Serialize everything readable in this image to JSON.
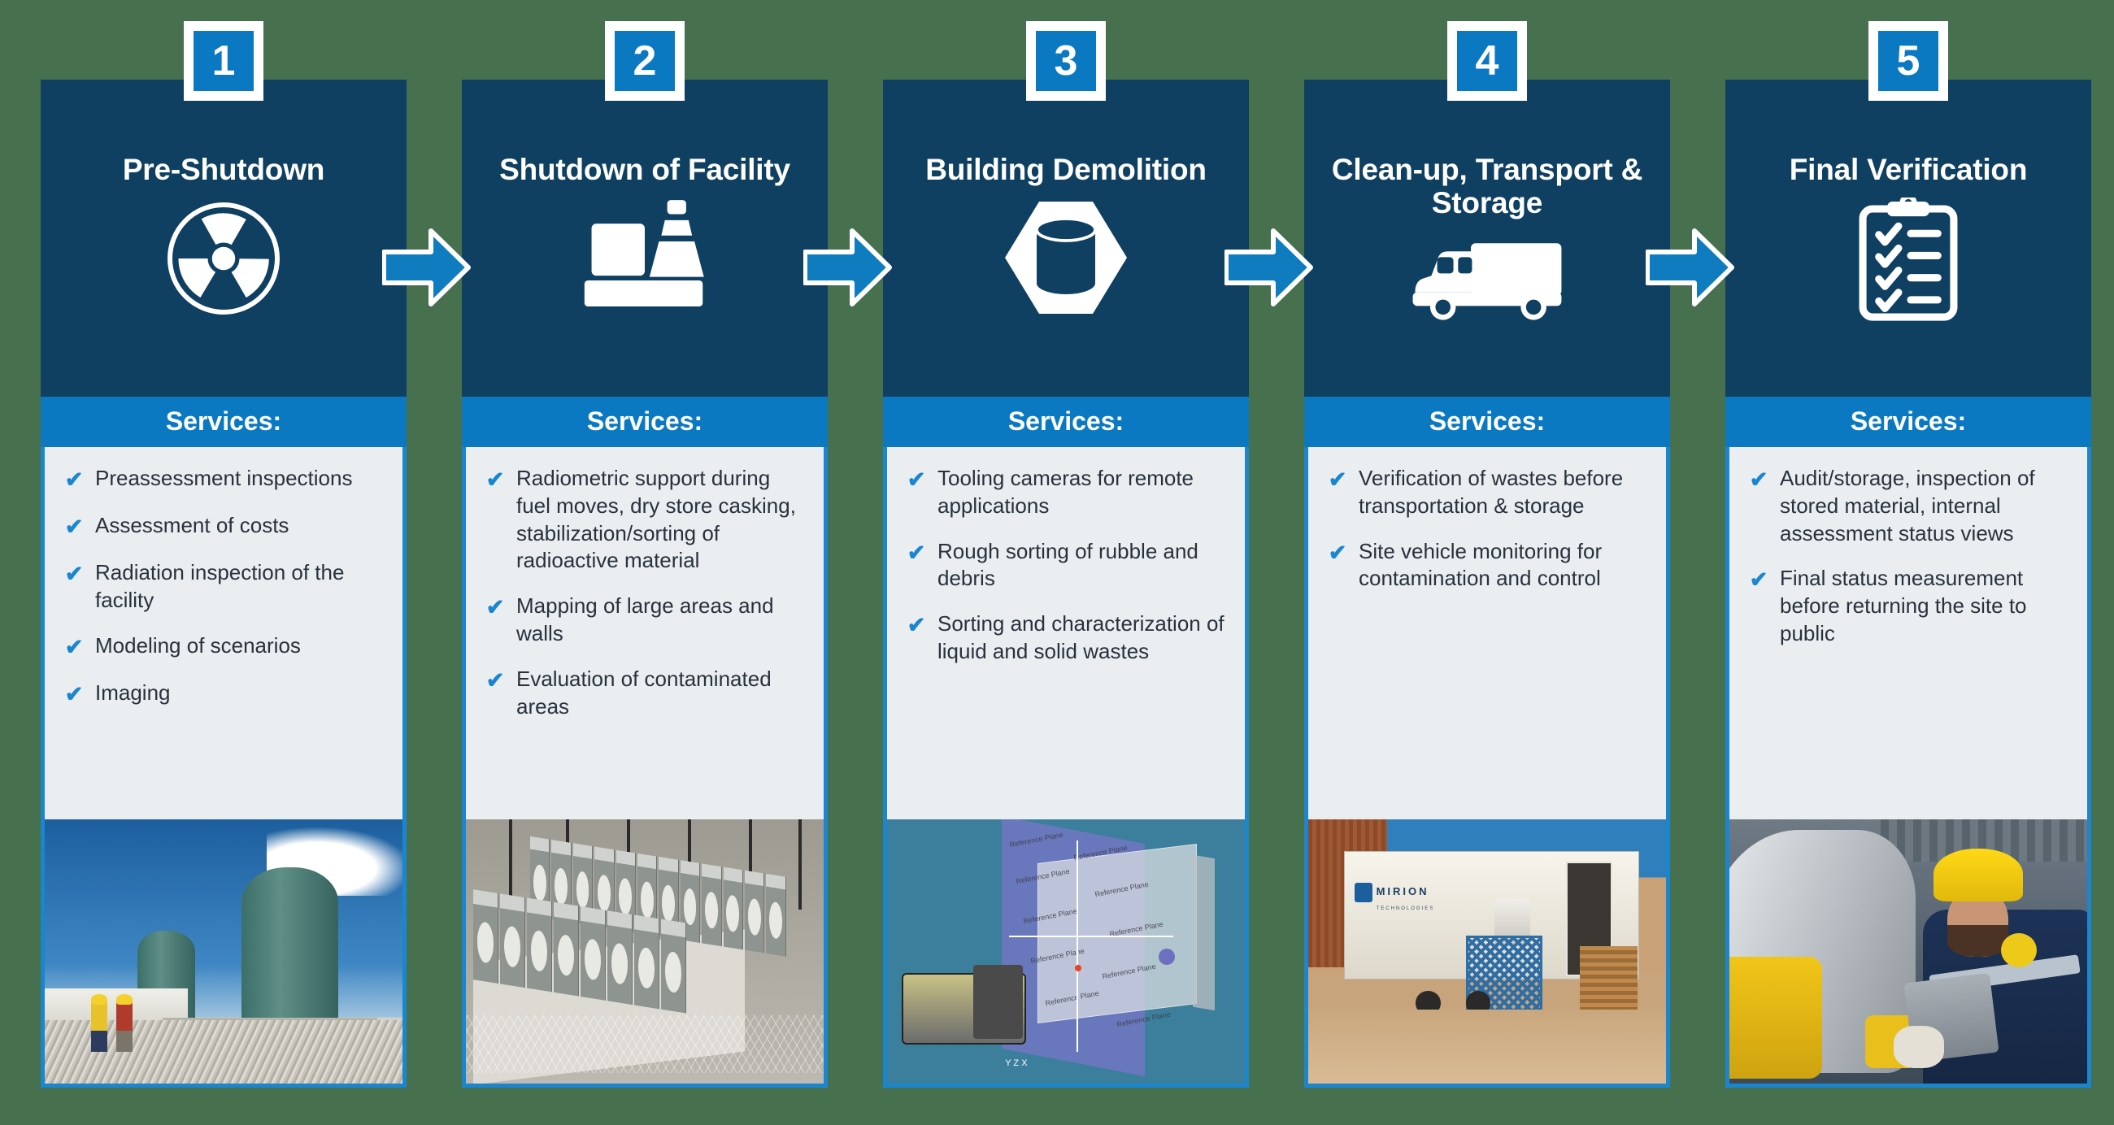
{
  "palette": {
    "background": "#47704f",
    "panel_dark": "#0f3f61",
    "accent_blue": "#0a79c1",
    "border_blue": "#1a86d0",
    "list_bg": "#eaeef1",
    "text_dark": "#28323c",
    "white": "#ffffff"
  },
  "services_label": "Services:",
  "check_glyph": "✔",
  "steps": [
    {
      "number": "1",
      "title": "Pre-Shutdown",
      "icon": "radiation-trefoil-icon",
      "services_label": "Services:",
      "items": [
        "Preassessment inspections",
        "Assessment of costs",
        "Radiation inspection of the facility",
        "Modeling of scenarios",
        "Imaging"
      ],
      "photo": "nuclear-cooling-towers-photo"
    },
    {
      "number": "2",
      "title": "Shutdown of Facility",
      "icon": "facility-cone-icon",
      "services_label": "Services:",
      "items": [
        "Radiometric support during fuel moves, dry store casking, stabilization/sorting of radioactive material",
        "Mapping of large areas and walls",
        "Evaluation of contaminated areas"
      ],
      "photo": "dry-cask-storage-photo"
    },
    {
      "number": "3",
      "title": "Building Demolition",
      "icon": "hexagon-cylinder-icon",
      "services_label": "Services:",
      "items": [
        "Tooling cameras for remote applications",
        "Rough sorting of rubble and debris",
        "Sorting and characterization of liquid and solid wastes"
      ],
      "photo": "3d-reference-plane-model-photo"
    },
    {
      "number": "4",
      "title": "Clean-up, Transport & Storage",
      "icon": "delivery-truck-icon",
      "services_label": "Services:",
      "items": [
        "Verification of wastes before transportation & storage",
        "Site vehicle monitoring for contamination and control"
      ],
      "photo": "mirion-mobile-trailer-photo"
    },
    {
      "number": "5",
      "title": "Final Verification",
      "icon": "clipboard-checklist-icon",
      "services_label": "Services:",
      "items": [
        "Audit/storage, inspection of stored material, internal assessment status views",
        "Final status measurement before returning the site to public"
      ],
      "photo": "inspector-with-tablet-photo"
    }
  ],
  "arrows": [
    {
      "name": "arrow-step-1-to-2"
    },
    {
      "name": "arrow-step-2-to-3"
    },
    {
      "name": "arrow-step-3-to-4"
    },
    {
      "name": "arrow-step-4-to-5"
    }
  ],
  "photo_captions": {
    "trailer_brand": "MIRION",
    "trailer_sub": "TECHNOLOGIES",
    "model_plane_label": "Reference Plane",
    "model_axis_x": "X",
    "model_axis_y": "Y",
    "model_axis_z": "Z"
  }
}
